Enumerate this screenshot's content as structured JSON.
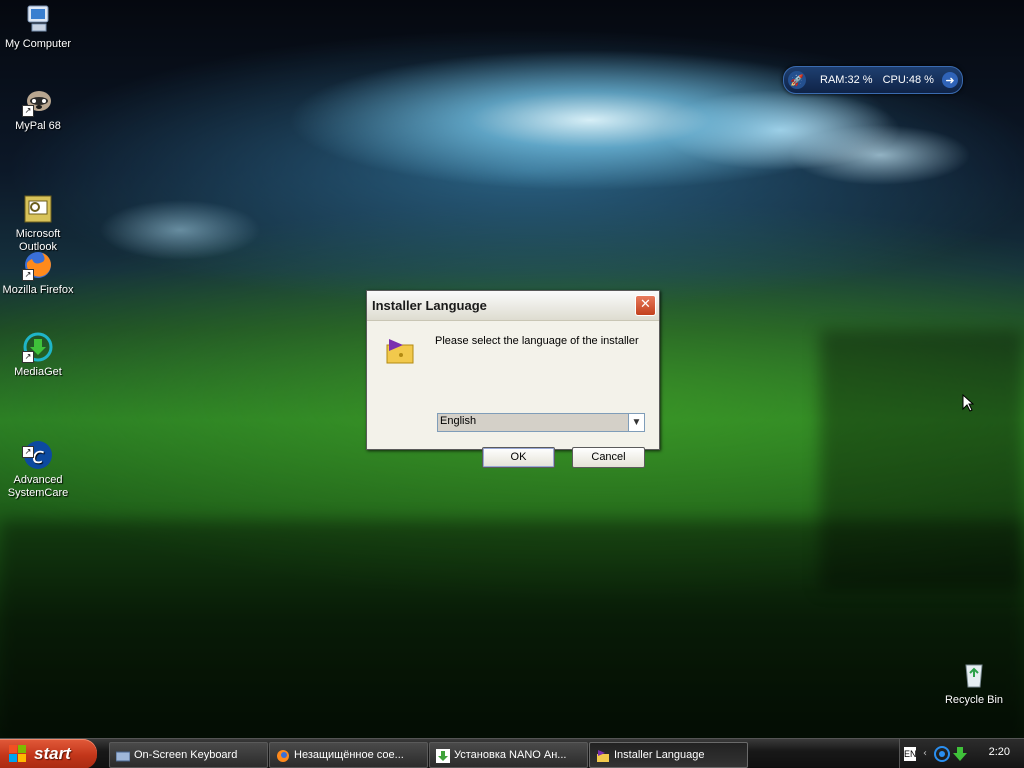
{
  "desktop": {
    "icons": [
      {
        "label": "My Computer"
      },
      {
        "label": "MyPal 68"
      },
      {
        "label": "Microsoft\nOutlook"
      },
      {
        "label": "Mozilla Firefox"
      },
      {
        "label": "MediaGet"
      },
      {
        "label": "Advanced\nSystemCare"
      },
      {
        "label": "Recycle Bin"
      }
    ]
  },
  "gadget": {
    "ram": "RAM:32 %",
    "cpu": "CPU:48 %"
  },
  "dialog": {
    "title": "Installer Language",
    "close_glyph": "✕",
    "message": "Please select the language of the installer",
    "language": {
      "selected": "English"
    },
    "ok_label": "OK",
    "cancel_label": "Cancel"
  },
  "taskbar": {
    "start_label": "start",
    "tasks": [
      {
        "label": "On-Screen Keyboard"
      },
      {
        "label": "Незащищённое сое..."
      },
      {
        "label": "Установка NANO Ан..."
      },
      {
        "label": "Installer Language"
      }
    ],
    "tray": {
      "lang": "EN",
      "time": "2:20"
    }
  },
  "colors": {
    "start": "#c2361a",
    "dialog_bg": "#ece9d8",
    "close": "#c2401d",
    "gadget": "#1e3f70"
  }
}
